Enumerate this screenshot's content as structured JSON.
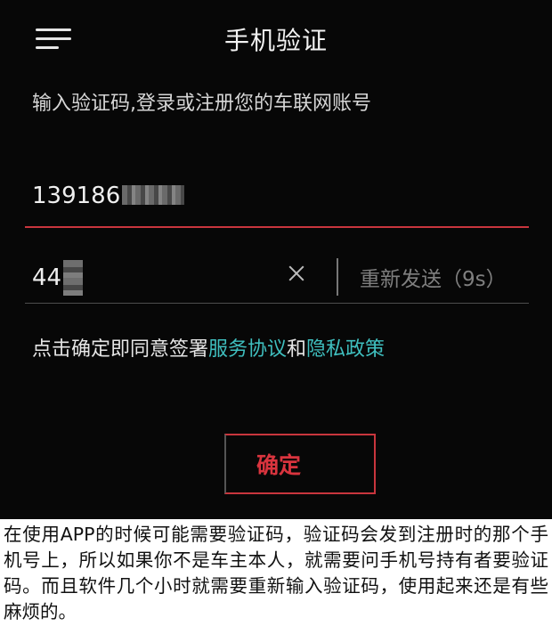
{
  "header": {
    "title": "手机验证",
    "menu_icon": "menu-icon"
  },
  "subtitle": "输入验证码,登录或注册您的车联网账号",
  "phone_field": {
    "value_visible": "139186"
  },
  "code_field": {
    "value_visible": "44",
    "clear_icon": "close-icon",
    "resend_label": "重新发送（9s）"
  },
  "agreement": {
    "prefix": "点击确定即同意签署",
    "service_link": "服务协议",
    "and": "和",
    "privacy_link": "隐私政策"
  },
  "confirm_button": {
    "label": "确定"
  },
  "caption": "在使用APP的时候可能需要验证码，验证码会发到注册时的那个手机号上，所以如果你不是车主本人，就需要问手机号持有者要验证码。而且软件几个小时就需要重新输入验证码，使用起来还是有些麻烦的。",
  "colors": {
    "background": "#070707",
    "accent_red": "#c8353d",
    "link_teal": "#3fbfbf"
  }
}
